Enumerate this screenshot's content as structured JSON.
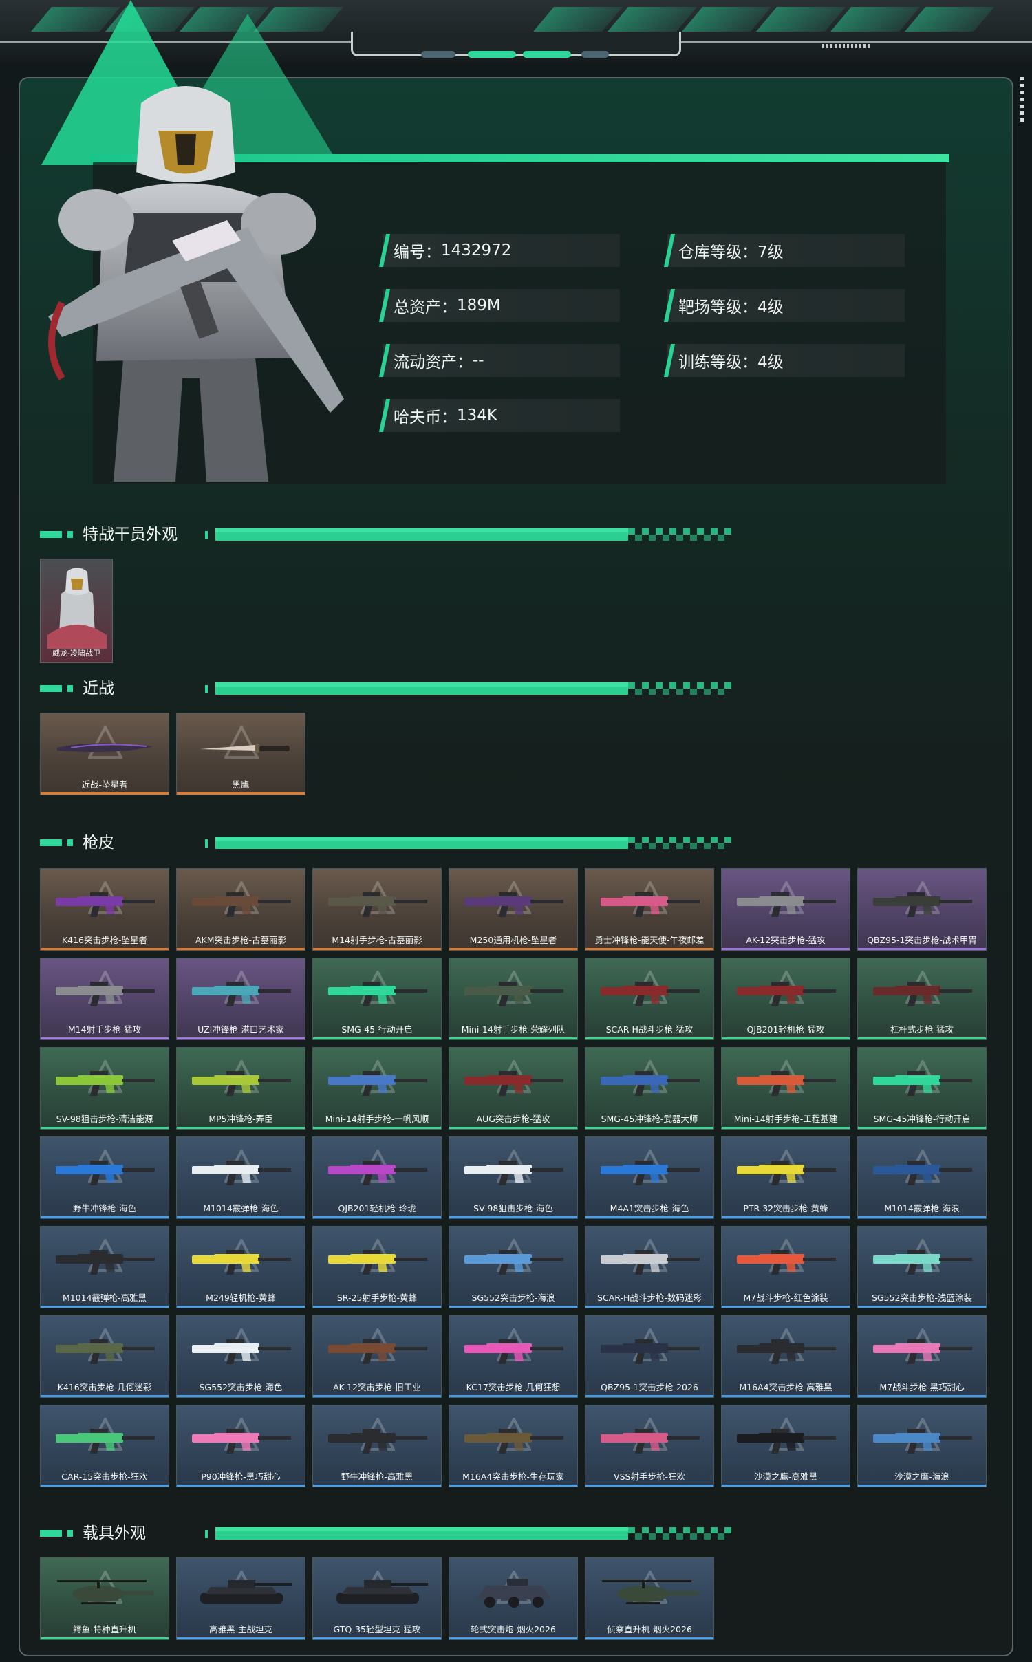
{
  "colors": {
    "accent": "#2fd89a",
    "gold_rarity": "#e07a2e",
    "purple_rarity": "#a676e0",
    "green_rarity": "#3fd48e",
    "blue_rarity": "#4b9ee8"
  },
  "profile": {
    "stats": [
      {
        "label": "编号：",
        "value": "1432972"
      },
      {
        "label": "仓库等级：",
        "value": "7级"
      },
      {
        "label": "总资产：",
        "value": "189M"
      },
      {
        "label": "靶场等级：",
        "value": "4级"
      },
      {
        "label": "流动资产：",
        "value": "--"
      },
      {
        "label": "训练等级：",
        "value": "4级"
      },
      {
        "label": "哈夫币：",
        "value": "134K"
      }
    ]
  },
  "sections": {
    "operator": {
      "title": "特战干员外观",
      "items": [
        {
          "name": "威龙-凌啸战卫"
        }
      ]
    },
    "melee": {
      "title": "近战",
      "items": [
        {
          "name": "近战-坠星者",
          "rarity": "gold",
          "icon": "knife-icon"
        },
        {
          "name": "黑鹰",
          "rarity": "gold",
          "icon": "bayonet-icon"
        }
      ]
    },
    "gun_skins": {
      "title": "枪皮",
      "items": [
        {
          "name": "K416突击步枪-坠星者",
          "rarity": "gold",
          "color": "#7a3aa8"
        },
        {
          "name": "AKM突击步枪-古墓丽影",
          "rarity": "gold",
          "color": "#6a4a38"
        },
        {
          "name": "M14射手步枪-古墓丽影",
          "rarity": "gold",
          "color": "#5a5848"
        },
        {
          "name": "M250通用机枪-坠星者",
          "rarity": "gold",
          "color": "#5a3a7a"
        },
        {
          "name": "勇士冲锋枪-能天使-午夜邮差",
          "rarity": "gold",
          "color": "#d85a88"
        },
        {
          "name": "AK-12突击步枪-猛攻",
          "rarity": "purple",
          "color": "#8a8c90"
        },
        {
          "name": "QBZ95-1突击步枪-战术甲胄",
          "rarity": "purple",
          "color": "#3a3e38"
        },
        {
          "name": "M14射手步枪-猛攻",
          "rarity": "purple",
          "color": "#8a8c90"
        },
        {
          "name": "UZI冲锋枪-港口艺术家",
          "rarity": "purple",
          "color": "#4aa8b8"
        },
        {
          "name": "SMG-45-行动开启",
          "rarity": "green",
          "color": "#2fd89a"
        },
        {
          "name": "Mini-14射手步枪-荣耀列队",
          "rarity": "green",
          "color": "#4a5a48"
        },
        {
          "name": "SCAR-H战斗步枪-猛攻",
          "rarity": "green",
          "color": "#8a2a2a"
        },
        {
          "name": "QJB201轻机枪-猛攻",
          "rarity": "green",
          "color": "#8a2a2a"
        },
        {
          "name": "杠杆式步枪-猛攻",
          "rarity": "green",
          "color": "#6a2a2a"
        },
        {
          "name": "SV-98狙击步枪-清洁能源",
          "rarity": "green",
          "color": "#8ac838"
        },
        {
          "name": "MP5冲锋枪-弄臣",
          "rarity": "green",
          "color": "#a8c838"
        },
        {
          "name": "Mini-14射手步枪-一帆风顺",
          "rarity": "green",
          "color": "#4a78c8"
        },
        {
          "name": "AUG突击步枪-猛攻",
          "rarity": "green",
          "color": "#8a2a2a"
        },
        {
          "name": "SMG-45冲锋枪-武器大师",
          "rarity": "green",
          "color": "#3a68b8"
        },
        {
          "name": "Mini-14射手步枪-工程基建",
          "rarity": "green",
          "color": "#d85a38"
        },
        {
          "name": "SMG-45冲锋枪-行动开启",
          "rarity": "green",
          "color": "#2fd89a"
        },
        {
          "name": "野牛冲锋枪-海色",
          "rarity": "blue",
          "color": "#2a78d8"
        },
        {
          "name": "M1014霰弹枪-海色",
          "rarity": "blue",
          "color": "#e8eef2"
        },
        {
          "name": "QJB201轻机枪-玲珑",
          "rarity": "blue",
          "color": "#b848c8"
        },
        {
          "name": "SV-98狙击步枪-海色",
          "rarity": "blue",
          "color": "#e8eef2"
        },
        {
          "name": "M4A1突击步枪-海色",
          "rarity": "blue",
          "color": "#2a78d8"
        },
        {
          "name": "PTR-32突击步枪-黄蜂",
          "rarity": "blue",
          "color": "#e8d838"
        },
        {
          "name": "M1014霰弹枪-海浪",
          "rarity": "blue",
          "color": "#2a5898"
        },
        {
          "name": "M1014霰弹枪-高雅黑",
          "rarity": "blue",
          "color": "#2a2c30"
        },
        {
          "name": "M249轻机枪-黄蜂",
          "rarity": "blue",
          "color": "#e8d838"
        },
        {
          "name": "SR-25射手步枪-黄蜂",
          "rarity": "blue",
          "color": "#e8d838"
        },
        {
          "name": "SG552突击步枪-海浪",
          "rarity": "blue",
          "color": "#5a9ad8"
        },
        {
          "name": "SCAR-H战斗步枪-数码迷彩",
          "rarity": "blue",
          "color": "#c8ccd0"
        },
        {
          "name": "M7战斗步枪-红色涂装",
          "rarity": "blue",
          "color": "#e8583a"
        },
        {
          "name": "SG552突击步枪-浅蓝涂装",
          "rarity": "blue",
          "color": "#7ad8c8"
        },
        {
          "name": "K416突击步枪-几何迷彩",
          "rarity": "blue",
          "color": "#5a6848"
        },
        {
          "name": "SG552突击步枪-海色",
          "rarity": "blue",
          "color": "#e8eef2"
        },
        {
          "name": "AK-12突击步枪-旧工业",
          "rarity": "blue",
          "color": "#7a4a32"
        },
        {
          "name": "KC17突击步枪-几何狂想",
          "rarity": "blue",
          "color": "#e858b8"
        },
        {
          "name": "QBZ95-1突击步枪-2026",
          "rarity": "blue",
          "color": "#2a3248"
        },
        {
          "name": "M16A4突击步枪-高雅黑",
          "rarity": "blue",
          "color": "#2a2c30"
        },
        {
          "name": "M7战斗步枪-黑巧甜心",
          "rarity": "blue",
          "color": "#e878b8"
        },
        {
          "name": "CAR-15突击步枪-狂欢",
          "rarity": "blue",
          "color": "#48c878"
        },
        {
          "name": "P90冲锋枪-黑巧甜心",
          "rarity": "blue",
          "color": "#f07ab8"
        },
        {
          "name": "野牛冲锋枪-高雅黑",
          "rarity": "blue",
          "color": "#2a2c30"
        },
        {
          "name": "M16A4突击步枪-生存玩家",
          "rarity": "blue",
          "color": "#6a5a38"
        },
        {
          "name": "VSS射手步枪-狂欢",
          "rarity": "blue",
          "color": "#d85a88"
        },
        {
          "name": "沙漠之鹰-高雅黑",
          "rarity": "blue",
          "color": "#1a1c20"
        },
        {
          "name": "沙漠之鹰-海浪",
          "rarity": "blue",
          "color": "#4a88c8"
        }
      ]
    },
    "vehicles": {
      "title": "载具外观",
      "items": [
        {
          "name": "鳄鱼-特种直升机",
          "rarity": "green",
          "icon": "helicopter-icon"
        },
        {
          "name": "高雅黑-主战坦克",
          "rarity": "blue",
          "icon": "tank-icon"
        },
        {
          "name": "GTQ-35轻型坦克-猛攻",
          "rarity": "blue",
          "icon": "light-tank-icon"
        },
        {
          "name": "轮式突击炮-烟火2026",
          "rarity": "blue",
          "icon": "armored-vehicle-icon"
        },
        {
          "name": "侦察直升机-烟火2026",
          "rarity": "blue",
          "icon": "scout-helicopter-icon"
        }
      ]
    }
  }
}
